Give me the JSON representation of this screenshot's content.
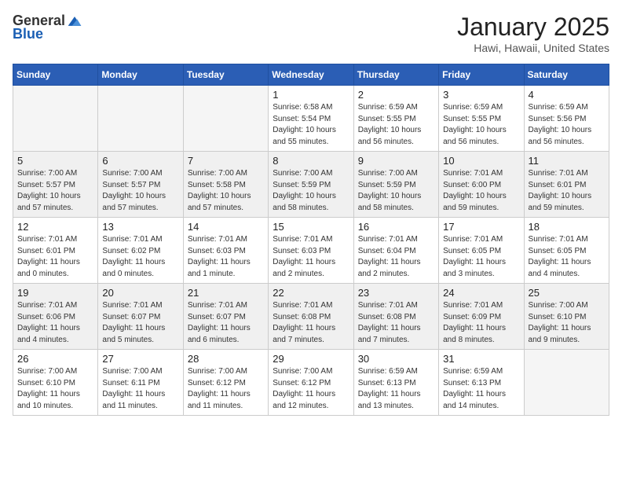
{
  "header": {
    "logo_general": "General",
    "logo_blue": "Blue",
    "title": "January 2025",
    "subtitle": "Hawi, Hawaii, United States"
  },
  "days_of_week": [
    "Sunday",
    "Monday",
    "Tuesday",
    "Wednesday",
    "Thursday",
    "Friday",
    "Saturday"
  ],
  "weeks": [
    [
      {
        "day": "",
        "info": ""
      },
      {
        "day": "",
        "info": ""
      },
      {
        "day": "",
        "info": ""
      },
      {
        "day": "1",
        "info": "Sunrise: 6:58 AM\nSunset: 5:54 PM\nDaylight: 10 hours and 55 minutes."
      },
      {
        "day": "2",
        "info": "Sunrise: 6:59 AM\nSunset: 5:55 PM\nDaylight: 10 hours and 56 minutes."
      },
      {
        "day": "3",
        "info": "Sunrise: 6:59 AM\nSunset: 5:55 PM\nDaylight: 10 hours and 56 minutes."
      },
      {
        "day": "4",
        "info": "Sunrise: 6:59 AM\nSunset: 5:56 PM\nDaylight: 10 hours and 56 minutes."
      }
    ],
    [
      {
        "day": "5",
        "info": "Sunrise: 7:00 AM\nSunset: 5:57 PM\nDaylight: 10 hours and 57 minutes."
      },
      {
        "day": "6",
        "info": "Sunrise: 7:00 AM\nSunset: 5:57 PM\nDaylight: 10 hours and 57 minutes."
      },
      {
        "day": "7",
        "info": "Sunrise: 7:00 AM\nSunset: 5:58 PM\nDaylight: 10 hours and 57 minutes."
      },
      {
        "day": "8",
        "info": "Sunrise: 7:00 AM\nSunset: 5:59 PM\nDaylight: 10 hours and 58 minutes."
      },
      {
        "day": "9",
        "info": "Sunrise: 7:00 AM\nSunset: 5:59 PM\nDaylight: 10 hours and 58 minutes."
      },
      {
        "day": "10",
        "info": "Sunrise: 7:01 AM\nSunset: 6:00 PM\nDaylight: 10 hours and 59 minutes."
      },
      {
        "day": "11",
        "info": "Sunrise: 7:01 AM\nSunset: 6:01 PM\nDaylight: 10 hours and 59 minutes."
      }
    ],
    [
      {
        "day": "12",
        "info": "Sunrise: 7:01 AM\nSunset: 6:01 PM\nDaylight: 11 hours and 0 minutes."
      },
      {
        "day": "13",
        "info": "Sunrise: 7:01 AM\nSunset: 6:02 PM\nDaylight: 11 hours and 0 minutes."
      },
      {
        "day": "14",
        "info": "Sunrise: 7:01 AM\nSunset: 6:03 PM\nDaylight: 11 hours and 1 minute."
      },
      {
        "day": "15",
        "info": "Sunrise: 7:01 AM\nSunset: 6:03 PM\nDaylight: 11 hours and 2 minutes."
      },
      {
        "day": "16",
        "info": "Sunrise: 7:01 AM\nSunset: 6:04 PM\nDaylight: 11 hours and 2 minutes."
      },
      {
        "day": "17",
        "info": "Sunrise: 7:01 AM\nSunset: 6:05 PM\nDaylight: 11 hours and 3 minutes."
      },
      {
        "day": "18",
        "info": "Sunrise: 7:01 AM\nSunset: 6:05 PM\nDaylight: 11 hours and 4 minutes."
      }
    ],
    [
      {
        "day": "19",
        "info": "Sunrise: 7:01 AM\nSunset: 6:06 PM\nDaylight: 11 hours and 4 minutes."
      },
      {
        "day": "20",
        "info": "Sunrise: 7:01 AM\nSunset: 6:07 PM\nDaylight: 11 hours and 5 minutes."
      },
      {
        "day": "21",
        "info": "Sunrise: 7:01 AM\nSunset: 6:07 PM\nDaylight: 11 hours and 6 minutes."
      },
      {
        "day": "22",
        "info": "Sunrise: 7:01 AM\nSunset: 6:08 PM\nDaylight: 11 hours and 7 minutes."
      },
      {
        "day": "23",
        "info": "Sunrise: 7:01 AM\nSunset: 6:08 PM\nDaylight: 11 hours and 7 minutes."
      },
      {
        "day": "24",
        "info": "Sunrise: 7:01 AM\nSunset: 6:09 PM\nDaylight: 11 hours and 8 minutes."
      },
      {
        "day": "25",
        "info": "Sunrise: 7:00 AM\nSunset: 6:10 PM\nDaylight: 11 hours and 9 minutes."
      }
    ],
    [
      {
        "day": "26",
        "info": "Sunrise: 7:00 AM\nSunset: 6:10 PM\nDaylight: 11 hours and 10 minutes."
      },
      {
        "day": "27",
        "info": "Sunrise: 7:00 AM\nSunset: 6:11 PM\nDaylight: 11 hours and 11 minutes."
      },
      {
        "day": "28",
        "info": "Sunrise: 7:00 AM\nSunset: 6:12 PM\nDaylight: 11 hours and 11 minutes."
      },
      {
        "day": "29",
        "info": "Sunrise: 7:00 AM\nSunset: 6:12 PM\nDaylight: 11 hours and 12 minutes."
      },
      {
        "day": "30",
        "info": "Sunrise: 6:59 AM\nSunset: 6:13 PM\nDaylight: 11 hours and 13 minutes."
      },
      {
        "day": "31",
        "info": "Sunrise: 6:59 AM\nSunset: 6:13 PM\nDaylight: 11 hours and 14 minutes."
      },
      {
        "day": "",
        "info": ""
      }
    ]
  ]
}
